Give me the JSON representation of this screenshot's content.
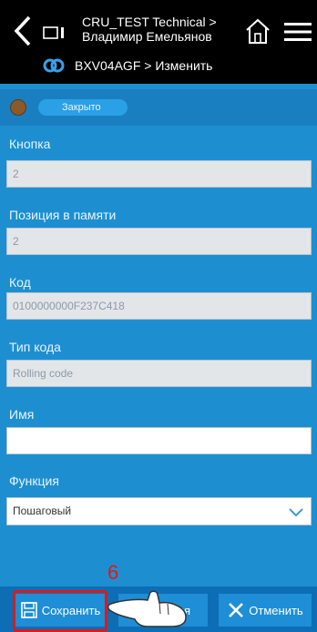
{
  "header": {
    "title_line1": "CRU_TEST Technical >",
    "title_line2": "Владимир Емельянов",
    "subtitle": "BXV04AGF > Изменить"
  },
  "status": {
    "label": "Закрыто",
    "dot_color": "#8a5a2b"
  },
  "fields": {
    "button": {
      "label": "Кнопка",
      "value": "2"
    },
    "memory": {
      "label": "Позиция в памяти",
      "value": "2"
    },
    "code": {
      "label": "Код",
      "value": "0100000000F237C418"
    },
    "code_type": {
      "label": "Тип кода",
      "value": "Rolling code"
    },
    "name": {
      "label": "Имя",
      "value": ""
    },
    "function": {
      "label": "Функция",
      "value": "Пошаговый"
    }
  },
  "toolbar": {
    "save_label": "Сохранить",
    "copy_label": "Копия",
    "cancel_label": "Отменить"
  },
  "annotation": {
    "step": "6",
    "highlight_color": "#e01818"
  },
  "colors": {
    "background": "#1d8fd1",
    "header": "#000000",
    "bottombar": "#0d6db5"
  }
}
